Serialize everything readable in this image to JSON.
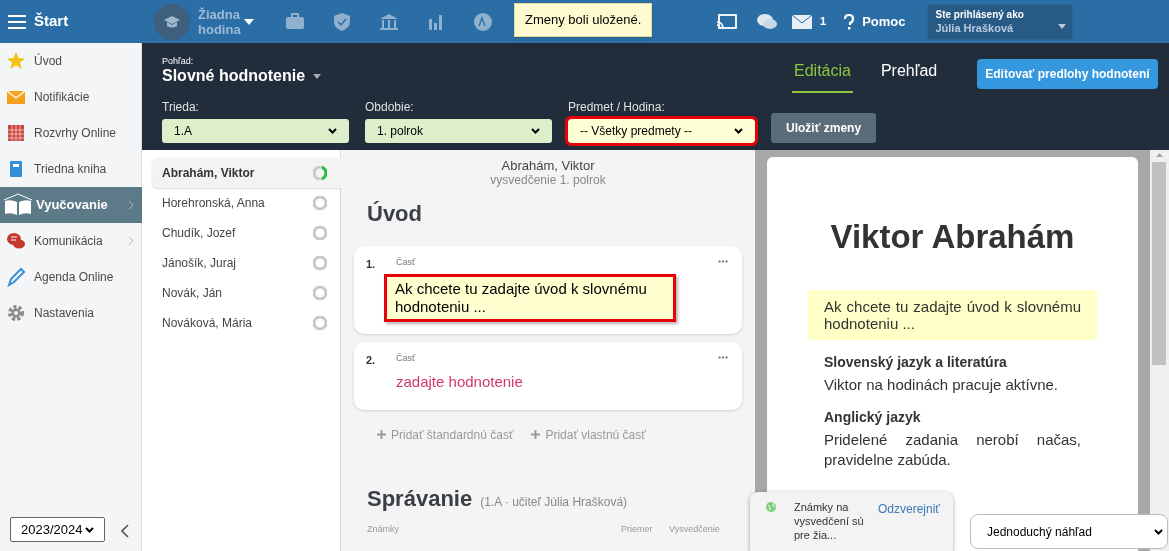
{
  "topbar": {
    "menu_label": "Štart",
    "lesson": "Žiadna hodina",
    "messages_count": "1",
    "help": "Pomoc",
    "user_caption": "Ste prihlásený ako",
    "user_name": "Júlia Hrašková"
  },
  "toast": "Zmeny boli uložené.",
  "sidebar": {
    "items": [
      {
        "label": "Úvod",
        "selected": false,
        "has_arrow": false
      },
      {
        "label": "Notifikácie",
        "selected": false,
        "has_arrow": false
      },
      {
        "label": "Rozvrhy Online",
        "selected": false,
        "has_arrow": false
      },
      {
        "label": "Triedna kniha",
        "selected": false,
        "has_arrow": false
      },
      {
        "label": "Vyučovanie",
        "selected": true,
        "has_arrow": true
      },
      {
        "label": "Komunikácia",
        "selected": false,
        "has_arrow": true
      },
      {
        "label": "Agenda Online",
        "selected": false,
        "has_arrow": false
      },
      {
        "label": "Nastavenia",
        "selected": false,
        "has_arrow": false
      }
    ],
    "year": "2023/2024"
  },
  "header": {
    "view_caption": "Pohľad:",
    "view": "Slovné hodnotenie",
    "tabs": [
      {
        "label": "Editácia",
        "selected": true
      },
      {
        "label": "Prehľad",
        "selected": false
      }
    ],
    "templates_button": "Editovať predlohy hodnotení",
    "filters": [
      {
        "label": "Trieda:",
        "value": "1.A",
        "highlighted": false
      },
      {
        "label": "Obdobie:",
        "value": "1. polrok",
        "highlighted": false
      },
      {
        "label": "Predmet / Hodina:",
        "value": "-- Všetky predmety --",
        "highlighted": true
      }
    ],
    "save_button": "Uložiť zmeny"
  },
  "students": [
    {
      "name": "Abrahám, Viktor",
      "selected": true,
      "level": 0.35
    },
    {
      "name": "Horehronská, Anna",
      "selected": false,
      "level": 0.03
    },
    {
      "name": "Chudík, Jozef",
      "selected": false,
      "level": 0.03
    },
    {
      "name": "Jánošík, Juraj",
      "selected": false,
      "level": 0
    },
    {
      "name": "Novák, Ján",
      "selected": false,
      "level": 0
    },
    {
      "name": "Nováková, Mária",
      "selected": false,
      "level": 0
    }
  ],
  "editor": {
    "student": "Abrahám, Viktor",
    "subtitle": "vysvedčenie 1. polrok",
    "section": "Úvod",
    "parts": [
      {
        "number": "1.",
        "caption": "Časť",
        "text": "Ak chcete tu zadajte úvod k slovnému hodnoteniu ...",
        "kind": "filled",
        "highlighted": true
      },
      {
        "number": "2.",
        "caption": "Časť",
        "text": "zadajte hodnotenie",
        "kind": "empty",
        "highlighted": false
      }
    ],
    "add_standard": "Pridať štandardnú časť",
    "add_custom": "Pridať vlastnú časť",
    "section2": "Správanie",
    "section2_note": "(1.A · učiteľ Júlia Hrašková)",
    "columns": [
      "Známky",
      "Priemer",
      "Vysvedčenie"
    ]
  },
  "preview": {
    "name": "Viktor Abrahám",
    "intro": "Ak chcete tu zadajte úvod k slovnému hodnoteniu ...",
    "subjects": [
      {
        "title": "Slovenský jazyk a literatúra",
        "text": "Viktor na hodinách pracuje aktívne."
      },
      {
        "title": "Anglický jazyk",
        "text": "Pridelené zadania nerobí načas, pravidelne zabúda."
      }
    ]
  },
  "notice": {
    "text": "Známky na vysvedčení sú pre žia...",
    "action": "Odzverejniť"
  },
  "preview_mode": "Jednoduchý náhľad"
}
